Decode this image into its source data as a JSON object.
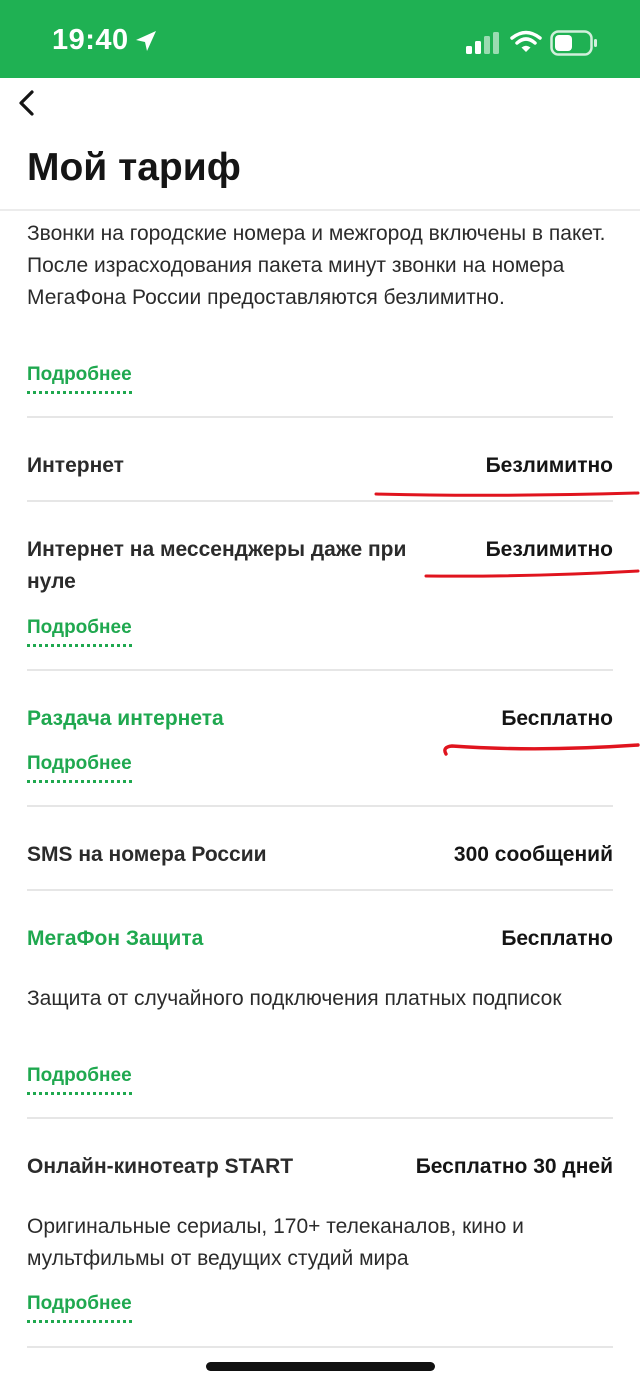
{
  "status_bar": {
    "time": "19:40",
    "background": "#1fb153"
  },
  "header": {
    "title": "Мой тариф"
  },
  "intro": {
    "description": "Звонки на городские номера и межгород включены в пакет. После израсходования пакета минут звонки на номера МегаФона России предоставляются безлимитно.",
    "more_link": "Подробнее"
  },
  "rows": [
    {
      "label": "Интернет",
      "value": "Безлимитно"
    },
    {
      "label": "Интернет на мессенджеры даже при нуле",
      "value": "Безлимитно",
      "more_link": "Подробнее"
    },
    {
      "label": "Раздача интернета",
      "value": "Бесплатно",
      "more_link": "Подробнее"
    },
    {
      "label": "SMS на номера России",
      "value": "300 сообщений"
    },
    {
      "label": "МегаФон Защита",
      "value": "Бесплатно",
      "description": "Защита от случайного подключения платных подписок",
      "more_link": "Подробнее"
    },
    {
      "label": "Онлайн-кинотеатр START",
      "value": "Бесплатно 30 дней",
      "description": "Оригинальные сериалы, 170+ телеканалов, кино и мультфильмы от ведущих студий мира",
      "more_link": "Подробнее"
    }
  ],
  "colors": {
    "accent_green": "#1fa84f",
    "annotation_red": "#e0141e"
  }
}
